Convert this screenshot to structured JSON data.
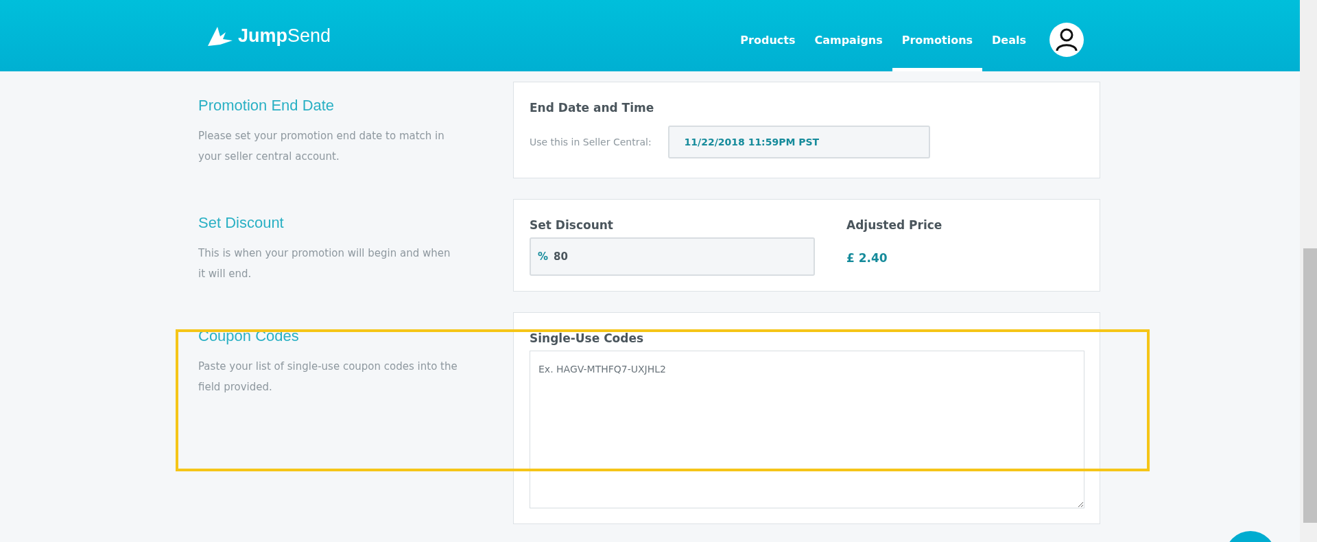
{
  "header": {
    "logo": {
      "bold": "Jump",
      "light": "Send"
    },
    "nav": [
      {
        "label": "Products",
        "selected": false
      },
      {
        "label": "Campaigns",
        "selected": false
      },
      {
        "label": "Promotions",
        "selected": true
      },
      {
        "label": "Deals",
        "selected": false
      }
    ]
  },
  "sections": [
    {
      "kind": "date",
      "title": "Promotion End Date",
      "description": "Please set your promotion end date to match in your seller central account.",
      "card_title": "End Date and Time",
      "field_label": "Use this in Seller Central:",
      "value": "11/22/2018 11:59PM PST"
    },
    {
      "kind": "discount",
      "title": "Set Discount",
      "description": "This is when your promotion will begin and when it will end.",
      "card_title": "Set Discount",
      "prefix": "%",
      "value": "80",
      "price_title": "Adjusted Price",
      "price": "£ 2.40"
    },
    {
      "kind": "codes",
      "title": "Coupon Codes",
      "description": "Paste your list of single-use coupon codes into the field provided.",
      "card_title": "Single-Use Codes",
      "placeholder": "Ex. HAGV-MTHFQ7-UXJHL2",
      "highlighted": true
    }
  ]
}
